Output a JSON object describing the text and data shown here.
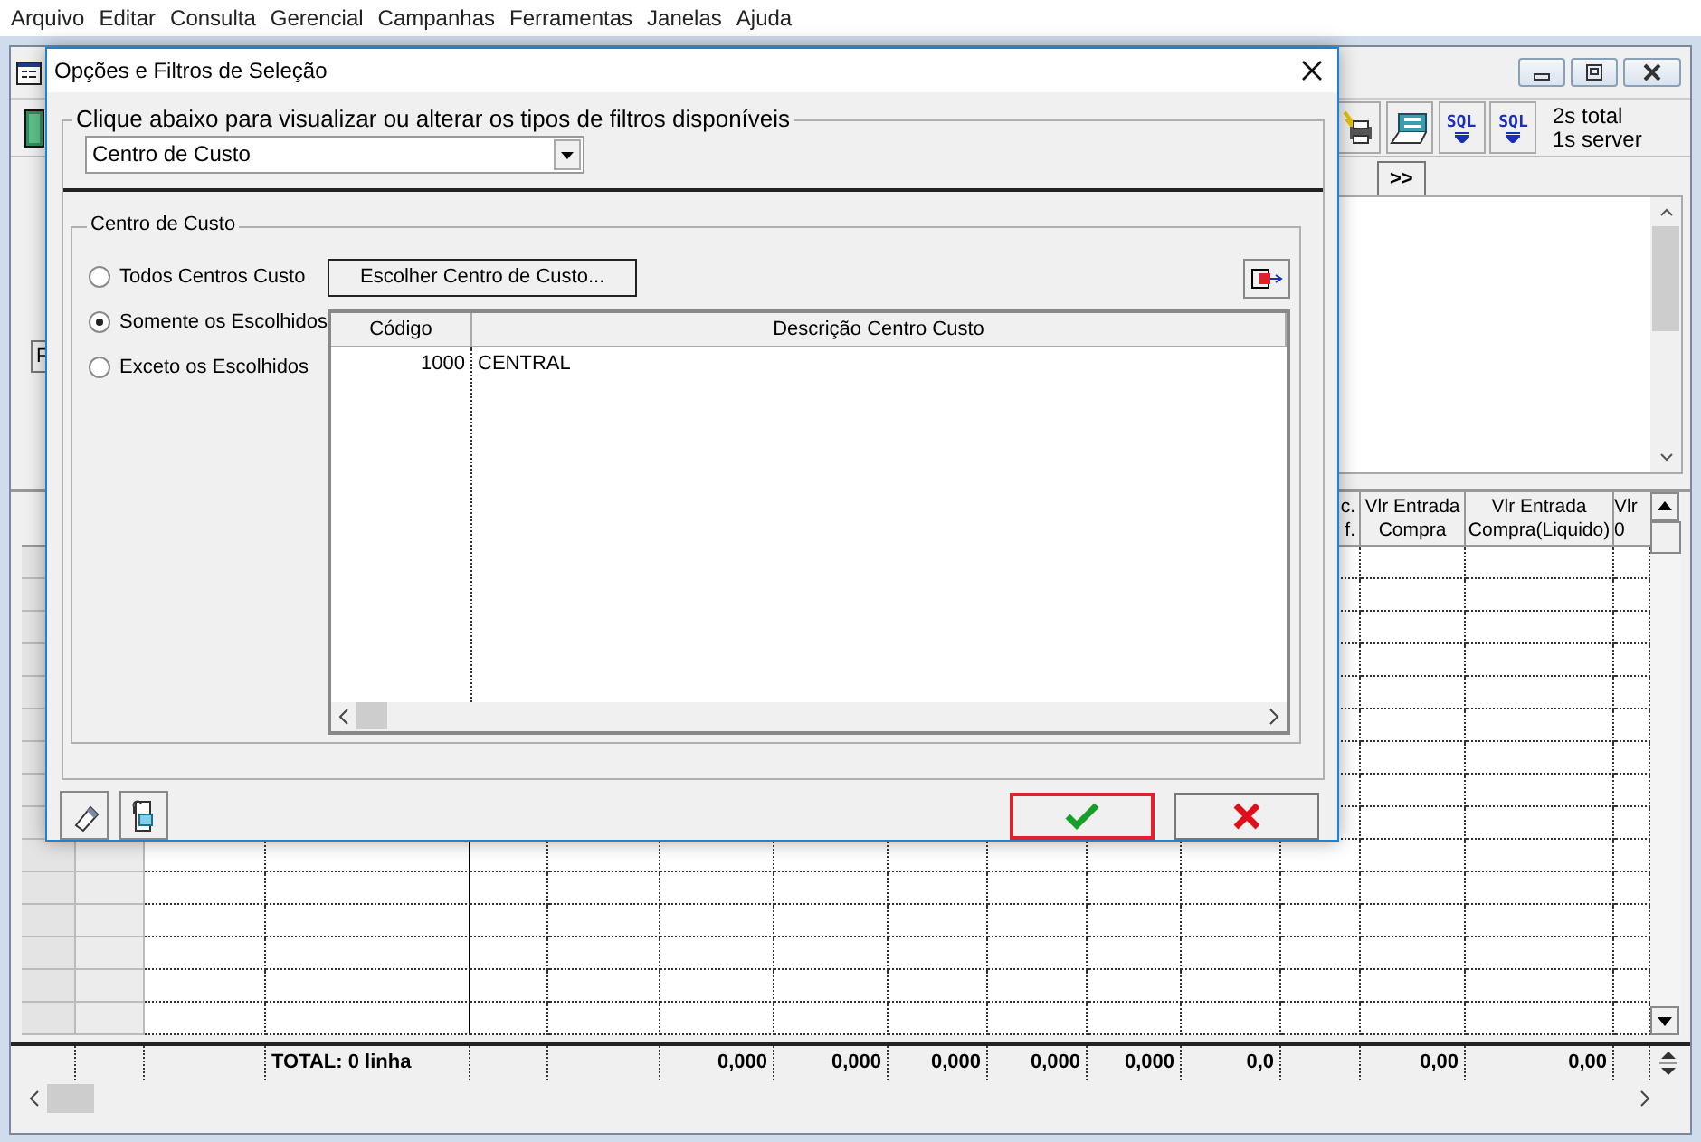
{
  "menu": [
    {
      "label": "Arquivo"
    },
    {
      "label": "Editar"
    },
    {
      "label": "Consulta"
    },
    {
      "label": "Gerencial"
    },
    {
      "label": "Campanhas"
    },
    {
      "label": "Ferramentas"
    },
    {
      "label": "Janelas"
    },
    {
      "label": "Ajuda"
    }
  ],
  "toolbar": {
    "sql_buttons": [
      {
        "label": "SQL"
      },
      {
        "label": "SQL"
      }
    ],
    "timing": [
      "2s total",
      "1s server"
    ]
  },
  "panel": {
    "partial_button": "F",
    "next_button": ">>"
  },
  "grid": {
    "headers": [
      {
        "lines": [
          "c.",
          "f."
        ]
      },
      {
        "lines": [
          "Vlr Entrada",
          "Compra"
        ]
      },
      {
        "lines": [
          "Vlr Entrada",
          "Compra(Liquido)"
        ]
      },
      {
        "lines": [
          "Vlr",
          "0"
        ]
      }
    ],
    "total_label": "TOTAL: 0 linha",
    "totals": [
      "0,000",
      "0,000",
      "0,000",
      "0,000",
      "0,000",
      "0,0",
      "0,00",
      "0,00"
    ]
  },
  "dialog": {
    "title": "Opções e Filtros de Seleção",
    "prompt": "Clique abaixo para visualizar ou alterar os tipos de filtros disponíveis",
    "filter_type": "Centro de Custo",
    "group": {
      "title": "Centro de Custo",
      "options": [
        {
          "label": "Todos Centros Custo",
          "selected": false
        },
        {
          "label": "Somente os Escolhidos",
          "selected": true
        },
        {
          "label": "Exceto os Escolhidos",
          "selected": false
        }
      ],
      "choose_button": "Escolher Centro de Custo...",
      "table": {
        "columns": [
          "Código",
          "Descrição Centro Custo"
        ],
        "rows": [
          [
            "1000",
            "CENTRAL"
          ]
        ]
      }
    },
    "ok_button": {
      "highlighted": true
    }
  }
}
